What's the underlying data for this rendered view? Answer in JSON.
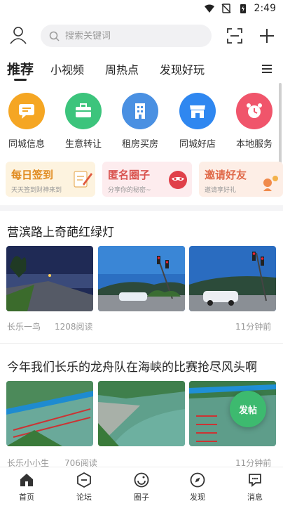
{
  "status_bar": {
    "time": "2:49",
    "icons": [
      "wifi-icon",
      "no-sim-icon",
      "battery-charging-icon"
    ]
  },
  "header": {
    "search_placeholder": "搜索关键词",
    "icons": [
      "avatar-icon",
      "search-icon",
      "scan-icon",
      "plus-icon"
    ]
  },
  "tabs": [
    {
      "label": "推荐",
      "active": true
    },
    {
      "label": "小视频",
      "active": false
    },
    {
      "label": "周热点",
      "active": false
    },
    {
      "label": "发现好玩",
      "active": false
    }
  ],
  "quick_links": [
    {
      "label": "同城信息",
      "icon": "message-icon",
      "color": "#f5a623"
    },
    {
      "label": "生意转让",
      "icon": "briefcase-icon",
      "color": "#3cc47c"
    },
    {
      "label": "租房买房",
      "icon": "building-icon",
      "color": "#4a90e2"
    },
    {
      "label": "同城好店",
      "icon": "store-icon",
      "color": "#2f87f0"
    },
    {
      "label": "本地服务",
      "icon": "alarm-clock-icon",
      "color": "#f0556b"
    }
  ],
  "banners": [
    {
      "title": "每日签到",
      "subtitle": "天天签到财神来到",
      "title_color": "#e08a1e",
      "bg": "#fdf3df",
      "icon": "pencil-note-icon"
    },
    {
      "title": "匿名圈子",
      "subtitle": "分享你的秘密~",
      "title_color": "#d9534f",
      "bg": "#fdecee",
      "icon": "mask-icon"
    },
    {
      "title": "邀请好友",
      "subtitle": "邀请享好礼",
      "title_color": "#e06a4a",
      "bg": "#fdeee6",
      "icon": "invite-icon"
    }
  ],
  "posts": [
    {
      "title": "营滨路上奇葩红绿灯",
      "author": "长乐一鸟",
      "reads": "1208阅读",
      "time": "11分钟前",
      "images": [
        "night-road-photo",
        "traffic-light-photo",
        "traffic-light-car-photo"
      ]
    },
    {
      "title": "今年我们长乐的龙舟队在海峡的比赛抢尽风头啊",
      "author": "长乐小小生",
      "reads": "706阅读",
      "time": "11分钟前",
      "images": [
        "dragon-boat-aerial-photo-1",
        "dragon-boat-aerial-photo-2",
        "dragon-boat-aerial-photo-3"
      ]
    }
  ],
  "fab": {
    "label": "发帖"
  },
  "bottom_nav": [
    {
      "label": "首页",
      "icon": "home-icon"
    },
    {
      "label": "论坛",
      "icon": "forum-icon"
    },
    {
      "label": "圈子",
      "icon": "circle-icon"
    },
    {
      "label": "发现",
      "icon": "discover-icon"
    },
    {
      "label": "消息",
      "icon": "message-bubble-icon"
    }
  ]
}
